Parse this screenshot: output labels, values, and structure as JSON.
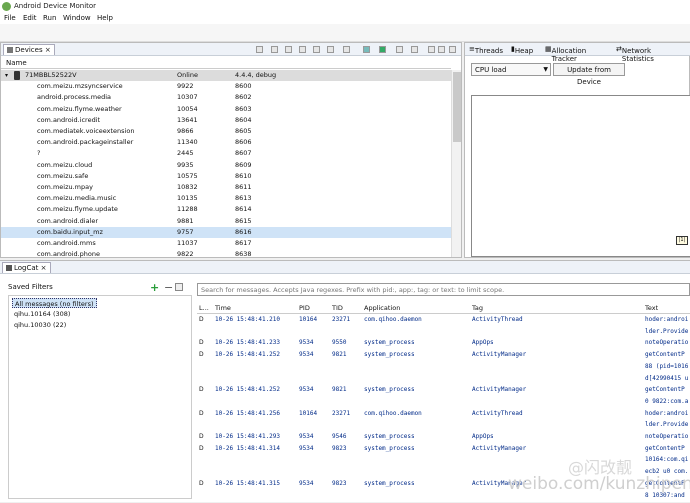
{
  "app": {
    "title": "Android Device Monitor"
  },
  "menu": [
    "File",
    "Edit",
    "Run",
    "Window",
    "Help"
  ],
  "devices": {
    "tab_label": "Devices",
    "column_header": "Name",
    "device": {
      "name": "71MBBL52522V",
      "state": "Online",
      "version": "4.4.4, debug"
    },
    "processes": [
      {
        "name": "com.meizu.mzsyncservice",
        "pid": "9922",
        "port": "8600"
      },
      {
        "name": "android.process.media",
        "pid": "10307",
        "port": "8602"
      },
      {
        "name": "com.meizu.flyme.weather",
        "pid": "10054",
        "port": "8603"
      },
      {
        "name": "com.android.icredit",
        "pid": "13641",
        "port": "8604"
      },
      {
        "name": "com.mediatek.voiceextension",
        "pid": "9866",
        "port": "8605"
      },
      {
        "name": "com.android.packageinstaller",
        "pid": "11340",
        "port": "8606"
      },
      {
        "name": "?",
        "pid": "2445",
        "port": "8607"
      },
      {
        "name": "com.meizu.cloud",
        "pid": "9935",
        "port": "8609"
      },
      {
        "name": "com.meizu.safe",
        "pid": "10575",
        "port": "8610"
      },
      {
        "name": "com.meizu.mpay",
        "pid": "10832",
        "port": "8611"
      },
      {
        "name": "com.meizu.media.music",
        "pid": "10135",
        "port": "8613"
      },
      {
        "name": "com.meizu.flyme.update",
        "pid": "11288",
        "port": "8614"
      },
      {
        "name": "com.android.dialer",
        "pid": "9881",
        "port": "8615"
      },
      {
        "name": "com.baidu.input_mz",
        "pid": "9757",
        "port": "8616"
      },
      {
        "name": "com.android.mms",
        "pid": "11037",
        "port": "8617"
      },
      {
        "name": "com.android.phone",
        "pid": "9822",
        "port": "8638"
      }
    ]
  },
  "right_panel": {
    "tabs": [
      "Threads",
      "Heap",
      "Allocation Tracker",
      "Network Statistics"
    ],
    "select_value": "CPU load",
    "update_button": "Update from Device",
    "chart_marker": "|1|"
  },
  "logcat": {
    "tab_label": "LogCat",
    "saved_filters_title": "Saved Filters",
    "filters": [
      "All messages (no filters)",
      "qihu.10164 (308)",
      "qihu.10030 (22)"
    ],
    "search_placeholder": "Search for messages. Accepts Java regexes. Prefix with pid:, app:, tag: or text: to limit scope.",
    "columns": [
      "L...",
      "Time",
      "PID",
      "TID",
      "Application",
      "Tag",
      "Text"
    ],
    "rows": [
      {
        "level": "D",
        "time": "10-26 15:48:41.210",
        "pid": "10164",
        "tid": "23271",
        "app": "com.qihoo.daemon",
        "tag": "ActivityThread",
        "text": "hoder:androi"
      },
      {
        "level": "",
        "time": "",
        "pid": "",
        "tid": "",
        "app": "",
        "tag": "",
        "text": "lder.Provide"
      },
      {
        "level": "D",
        "time": "10-26 15:48:41.233",
        "pid": "9534",
        "tid": "9550",
        "app": "system_process",
        "tag": "AppOps",
        "text": "noteOperatio"
      },
      {
        "level": "D",
        "time": "10-26 15:48:41.252",
        "pid": "9534",
        "tid": "9821",
        "app": "system_process",
        "tag": "ActivityManager",
        "text": "getContentP"
      },
      {
        "level": "",
        "time": "",
        "pid": "",
        "tid": "",
        "app": "",
        "tag": "",
        "text": "88 (pid=1016"
      },
      {
        "level": "",
        "time": "",
        "pid": "",
        "tid": "",
        "app": "",
        "tag": "",
        "text": "d[42990415 u"
      },
      {
        "level": "D",
        "time": "10-26 15:48:41.252",
        "pid": "9534",
        "tid": "9821",
        "app": "system_process",
        "tag": "ActivityManager",
        "text": "getContentP"
      },
      {
        "level": "",
        "time": "",
        "pid": "",
        "tid": "",
        "app": "",
        "tag": "",
        "text": "0 9822:com.a"
      },
      {
        "level": "D",
        "time": "10-26 15:48:41.256",
        "pid": "10164",
        "tid": "23271",
        "app": "com.qihoo.daemon",
        "tag": "ActivityThread",
        "text": "hoder:androi"
      },
      {
        "level": "",
        "time": "",
        "pid": "",
        "tid": "",
        "app": "",
        "tag": "",
        "text": "lder.Provide"
      },
      {
        "level": "D",
        "time": "10-26 15:48:41.293",
        "pid": "9534",
        "tid": "9546",
        "app": "system_process",
        "tag": "AppOps",
        "text": "noteOperatio"
      },
      {
        "level": "D",
        "time": "10-26 15:48:41.314",
        "pid": "9534",
        "tid": "9823",
        "app": "system_process",
        "tag": "ActivityManager",
        "text": "getContentP"
      },
      {
        "level": "",
        "time": "",
        "pid": "",
        "tid": "",
        "app": "",
        "tag": "",
        "text": "10164:com.qi"
      },
      {
        "level": "",
        "time": "",
        "pid": "",
        "tid": "",
        "app": "",
        "tag": "",
        "text": "ecb2 u0 com."
      },
      {
        "level": "D",
        "time": "10-26 15:48:41.315",
        "pid": "9534",
        "tid": "9823",
        "app": "system_process",
        "tag": "ActivityManager",
        "text": "getContentP"
      },
      {
        "level": "",
        "time": "",
        "pid": "",
        "tid": "",
        "app": "",
        "tag": "",
        "text": "8 10307:and"
      }
    ]
  },
  "watermark": {
    "line1": "@闪改靓",
    "line2": "weibo.com/kunzhipeng"
  }
}
